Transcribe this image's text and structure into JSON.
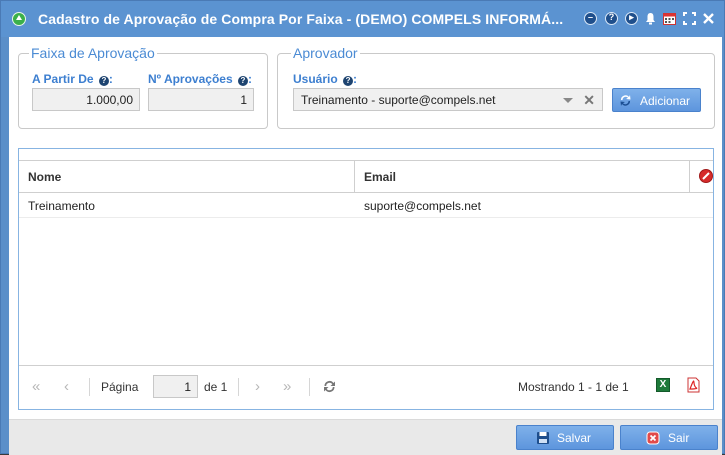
{
  "window": {
    "title": "Cadastro de Aprovação de Compra Por Faixa - (DEMO) COMPELS INFORMÁ..."
  },
  "titlebar_icons": [
    "minimize-icon",
    "help-icon",
    "play-icon",
    "bell-icon",
    "calendar-icon",
    "maximize-icon",
    "close-icon"
  ],
  "faixa": {
    "legend": "Faixa de Aprovação",
    "a_partir_label": "A Partir De",
    "a_partir_value": "1.000,00",
    "num_aprov_label": "Nº Aprovações",
    "num_aprov_value": "1",
    "help": "?"
  },
  "aprovador": {
    "legend": "Aprovador",
    "usuario_label": "Usuário",
    "usuario_value": "Treinamento - suporte@compels.net",
    "clear": "✕",
    "add_label": "Adicionar"
  },
  "grid": {
    "columns": [
      "Nome",
      "Email"
    ],
    "rows": [
      {
        "nome": "Treinamento",
        "email": "suporte@compels.net"
      }
    ]
  },
  "pager": {
    "page_label": "Página",
    "page_value": "1",
    "of_label": "de 1",
    "showing": "Mostrando 1 - 1 de 1"
  },
  "footer": {
    "save_label": "Salvar",
    "exit_label": "Sair"
  },
  "colors": {
    "titlebar": "#5b93d1",
    "accent": "#3d7fd0",
    "button": "#6aa2e2"
  }
}
